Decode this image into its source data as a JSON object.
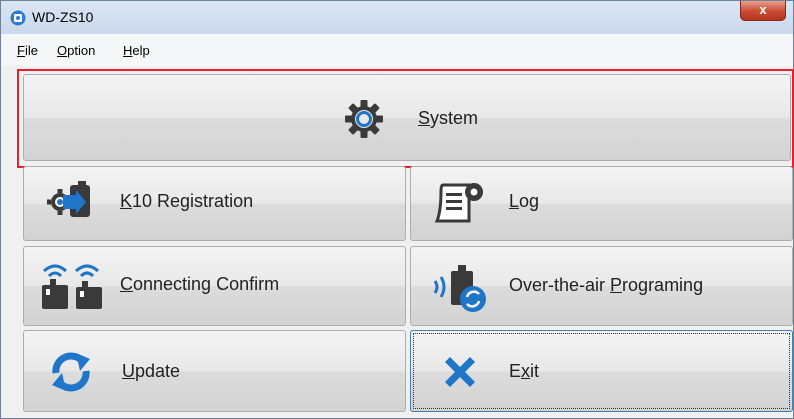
{
  "window": {
    "title": "WD-ZS10",
    "close_label": "x"
  },
  "menu": {
    "items": [
      "File",
      "Option",
      "Help"
    ]
  },
  "buttons": {
    "system": {
      "label_prefix": "",
      "mnemonic": "S",
      "label_rest": "ystem"
    },
    "k10": {
      "label_prefix": "",
      "mnemonic": "K",
      "label_rest": "10 Registration"
    },
    "log": {
      "label_prefix": "",
      "mnemonic": "L",
      "label_rest": "og"
    },
    "connecting": {
      "label_prefix": "",
      "mnemonic": "C",
      "label_rest": "onnecting Confirm"
    },
    "ota": {
      "label_prefix": "Over-the-air ",
      "mnemonic": "P",
      "label_rest": "rograming"
    },
    "update": {
      "label_prefix": "",
      "mnemonic": "U",
      "label_rest": "pdate"
    },
    "exit": {
      "label_prefix": "E",
      "mnemonic": "x",
      "label_rest": "it"
    }
  },
  "colors": {
    "accent_blue": "#1f75c8",
    "icon_dark": "#3a3a3a",
    "highlight_red": "#e0232d"
  },
  "icons": [
    "gear-icon",
    "k10-registration-icon",
    "log-icon",
    "connecting-confirm-icon",
    "ota-programming-icon",
    "update-icon",
    "exit-x-icon"
  ]
}
